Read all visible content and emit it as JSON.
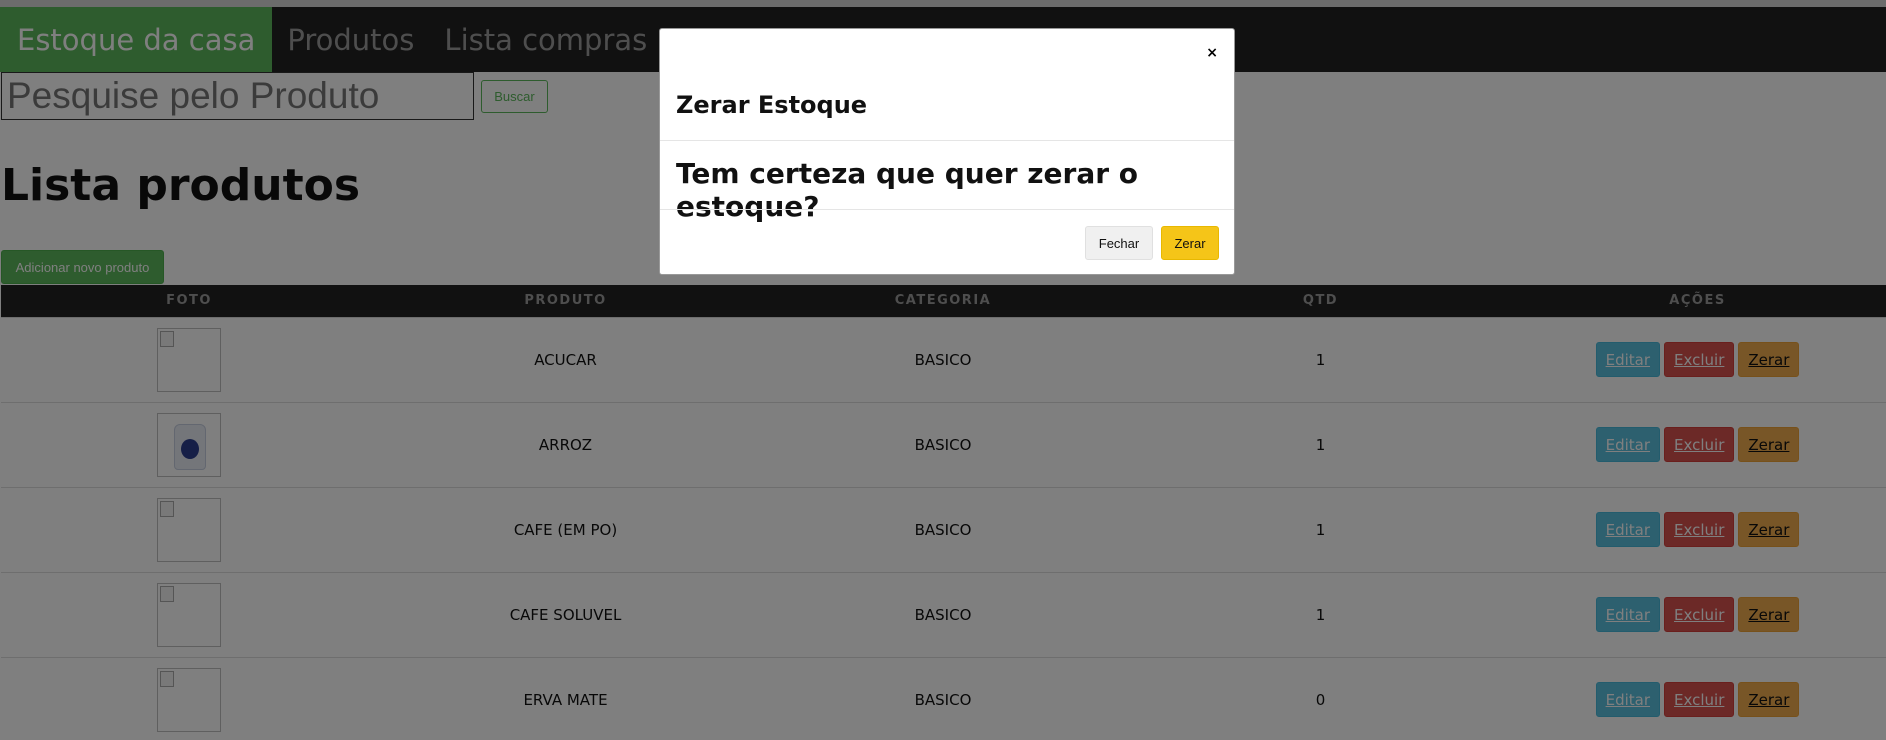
{
  "navbar": {
    "brand": "Estoque da casa",
    "items": [
      {
        "label": "Produtos"
      },
      {
        "label": "Lista compras"
      }
    ]
  },
  "search": {
    "placeholder": "Pesquise pelo Produto",
    "button_label": "Buscar"
  },
  "page_title": "Lista produtos",
  "add_button_label": "Adicionar novo produto",
  "table": {
    "headers": [
      "FOTO",
      "PRODUTO",
      "CATEGORIA",
      "QTD",
      "AÇÕES"
    ],
    "rows": [
      {
        "produto": "ACUCAR",
        "categoria": "BASICO",
        "qtd": "1",
        "photo": "broken-image-icon"
      },
      {
        "produto": "ARROZ",
        "categoria": "BASICO",
        "qtd": "1",
        "photo": "product-photo"
      },
      {
        "produto": "CAFE (EM PO)",
        "categoria": "BASICO",
        "qtd": "1",
        "photo": "broken-image-icon"
      },
      {
        "produto": "CAFE SOLUVEL",
        "categoria": "BASICO",
        "qtd": "1",
        "photo": "broken-image-icon"
      },
      {
        "produto": "ERVA MATE",
        "categoria": "BASICO",
        "qtd": "0",
        "photo": "broken-image-icon"
      }
    ],
    "actions": {
      "edit_label": "Editar",
      "delete_label": "Excluir",
      "zero_label": "Zerar"
    }
  },
  "modal": {
    "close_symbol": "×",
    "title": "Zerar Estoque",
    "body": "Tem certeza que quer zerar o estoque?",
    "cancel_label": "Fechar",
    "confirm_label": "Zerar"
  },
  "colors": {
    "navbar_bg": "#222222",
    "brand_bg": "#5cb85c",
    "edit": "#5bc0de",
    "delete": "#d9534f",
    "zero": "#f0ad4e",
    "modal_confirm": "#f5c518"
  }
}
